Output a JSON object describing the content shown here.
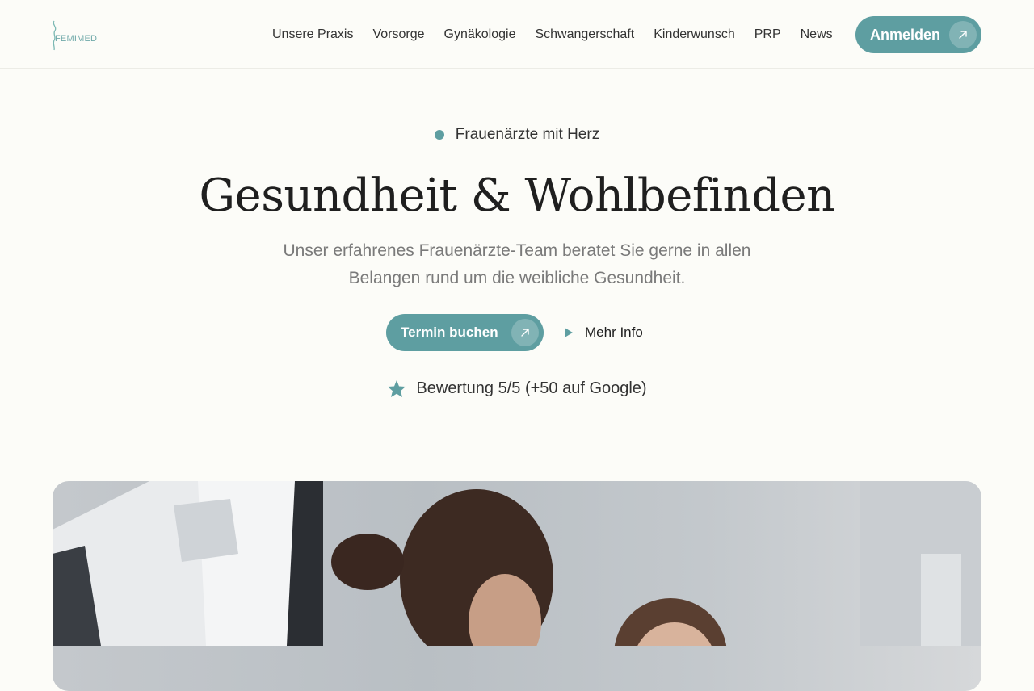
{
  "brand": {
    "logo_text": "FEMIMED"
  },
  "nav": {
    "items": [
      "Unsere Praxis",
      "Vorsorge",
      "Gynäkologie",
      "Schwangerschaft",
      "Kinderwunsch",
      "PRP",
      "News"
    ]
  },
  "header": {
    "login_label": "Anmelden"
  },
  "hero": {
    "tagline": "Frauenärzte mit Herz",
    "title": "Gesundheit & Wohlbefinden",
    "subtitle_line1": "Unser erfahrenes Frauenärzte-Team beratet Sie gerne in allen",
    "subtitle_line2": "Belangen rund um die weibliche Gesundheit.",
    "cta_primary": "Termin buchen",
    "cta_secondary": "Mehr Info",
    "rating": "Bewertung 5/5 (+50 auf Google)"
  },
  "icons": {
    "button_arrow": "arrow-up-right-icon",
    "secondary_cta": "play-icon",
    "rating": "star-icon",
    "tagline": "dot-icon"
  },
  "colors": {
    "accent": "#5e9ea1",
    "background": "#fcfcf8",
    "text": "#1f1f1f",
    "muted": "#7a7a7a"
  }
}
